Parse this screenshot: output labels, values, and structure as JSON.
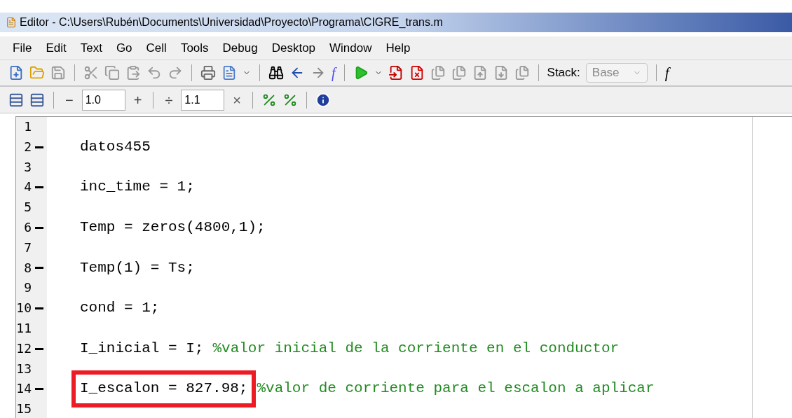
{
  "window": {
    "title": "Editor - C:\\Users\\Rubén\\Documents\\Universidad\\Proyecto\\Programa\\CIGRE_trans.m"
  },
  "menu": [
    "File",
    "Edit",
    "Text",
    "Go",
    "Cell",
    "Tools",
    "Debug",
    "Desktop",
    "Window",
    "Help"
  ],
  "toolbar": {
    "function_label": "f",
    "stack_label": "Stack:",
    "stack_value": "Base",
    "fx_cut": "f"
  },
  "cell_toolbar": {
    "minus": "−",
    "decrement": "1.0",
    "plus": "+",
    "divide": "÷",
    "factor": "1.1",
    "times": "×"
  },
  "code": [
    {
      "number": "1",
      "executable": false,
      "highlighted": false
    },
    {
      "number": "2",
      "executable": true,
      "code": "datos455",
      "highlighted": false
    },
    {
      "number": "3",
      "executable": false,
      "highlighted": false
    },
    {
      "number": "4",
      "executable": true,
      "code": "inc_time = 1;",
      "highlighted": false
    },
    {
      "number": "5",
      "executable": false,
      "highlighted": false
    },
    {
      "number": "6",
      "executable": true,
      "code": "Temp = zeros(4800,1);",
      "highlighted": false
    },
    {
      "number": "7",
      "executable": false,
      "highlighted": false
    },
    {
      "number": "8",
      "executable": true,
      "code": "Temp(1) = Ts;",
      "highlighted": false
    },
    {
      "number": "9",
      "executable": false,
      "highlighted": false
    },
    {
      "number": "10",
      "executable": true,
      "code": "cond = 1;",
      "highlighted": false
    },
    {
      "number": "11",
      "executable": false,
      "highlighted": false
    },
    {
      "number": "12",
      "executable": true,
      "code": "I_inicial = I;",
      "comment": "%valor inicial de la corriente en el conductor",
      "highlighted": false
    },
    {
      "number": "13",
      "executable": false,
      "highlighted": false
    },
    {
      "number": "14",
      "executable": true,
      "code": "I_escalon = 827.98;",
      "comment": "%valor de corriente para el escalon a aplicar",
      "highlighted": true
    },
    {
      "number": "15",
      "executable": false,
      "highlighted": false
    }
  ]
}
